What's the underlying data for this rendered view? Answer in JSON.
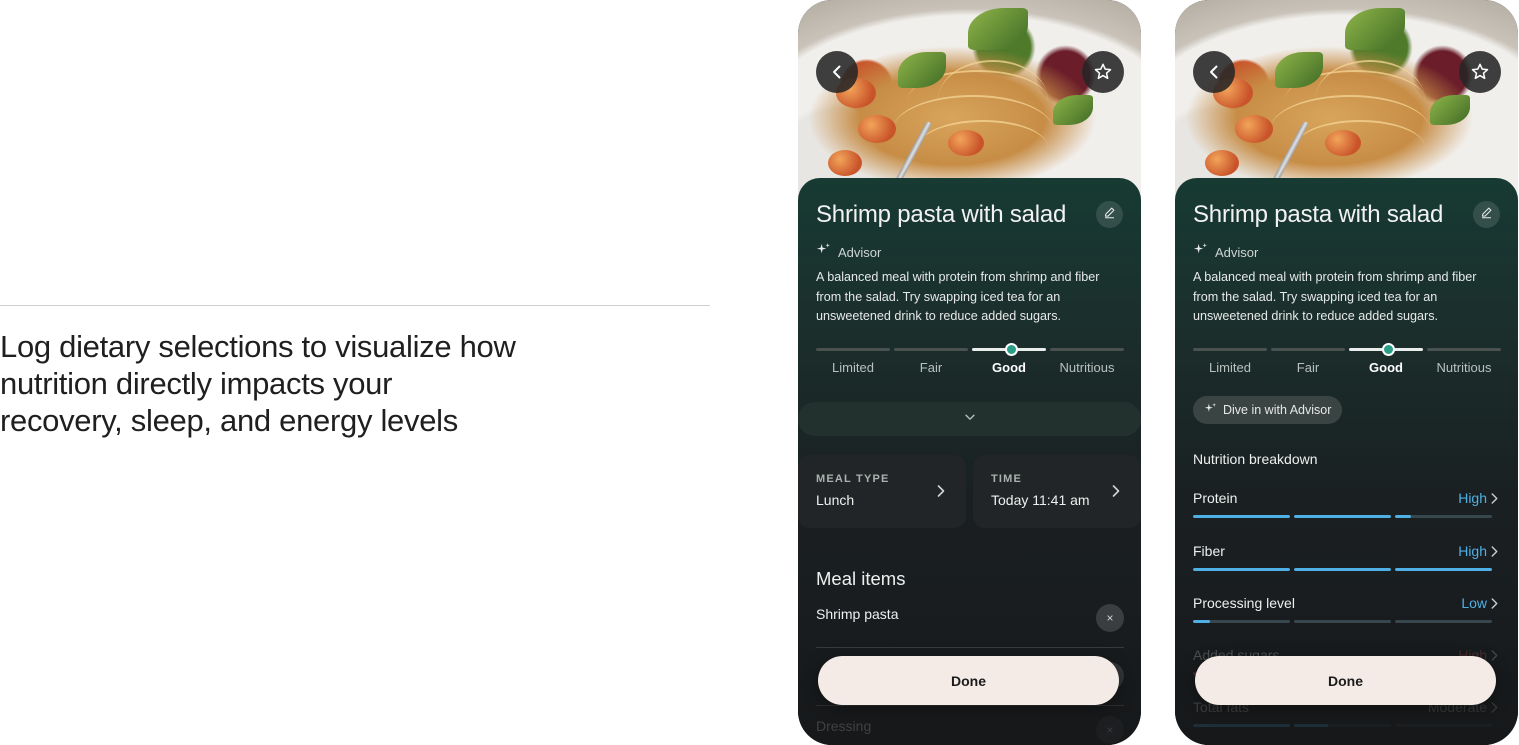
{
  "caption": "Log dietary selections to visualize how nutrition directly impacts your recovery, sleep, and energy levels",
  "meal": {
    "title": "Shrimp pasta with salad",
    "advisor_label": "Advisor",
    "advisor_text": "A balanced meal with protein from shrimp and fiber from the salad. Try swapping iced tea for an unsweetened drink to reduce added sugars.",
    "scale": [
      "Limited",
      "Fair",
      "Good",
      "Nutritious"
    ],
    "rating": "Good",
    "done_label": "Done"
  },
  "screen_a": {
    "meal_type_caption": "MEAL TYPE",
    "meal_type_value": "Lunch",
    "time_caption": "TIME",
    "time_value": "Today 11:41 am",
    "meal_items_title": "Meal items",
    "items": [
      "Shrimp pasta",
      "Dressing"
    ],
    "remove_glyph": "×"
  },
  "screen_b": {
    "advisor_chip_label": "Dive in with Advisor",
    "breakdown_title": "Nutrition breakdown",
    "metrics": [
      {
        "name": "Protein",
        "value": "High",
        "level": 0.72
      },
      {
        "name": "Fiber",
        "value": "High",
        "level": 1.0
      },
      {
        "name": "Processing level",
        "value": "Low",
        "level": 0.06
      },
      {
        "name": "Added sugars",
        "value": "High",
        "level": 0.72
      },
      {
        "name": "Total fats",
        "value": "Moderate",
        "level": 0.45
      }
    ]
  },
  "colors": {
    "accent_blue": "#4fb0e6",
    "rating_knob": "#2a9d86",
    "done_button": "#f4ebe6",
    "sheet_top": "#173a33",
    "warning_red": "#e0645a"
  },
  "icons": {
    "back": "chevron-left-icon",
    "favorite": "star-icon",
    "edit": "pencil-icon",
    "advisor": "sparkle-icon",
    "expand": "chevron-down-icon",
    "row_chevron": "chevron-right-icon",
    "remove": "close-icon"
  }
}
